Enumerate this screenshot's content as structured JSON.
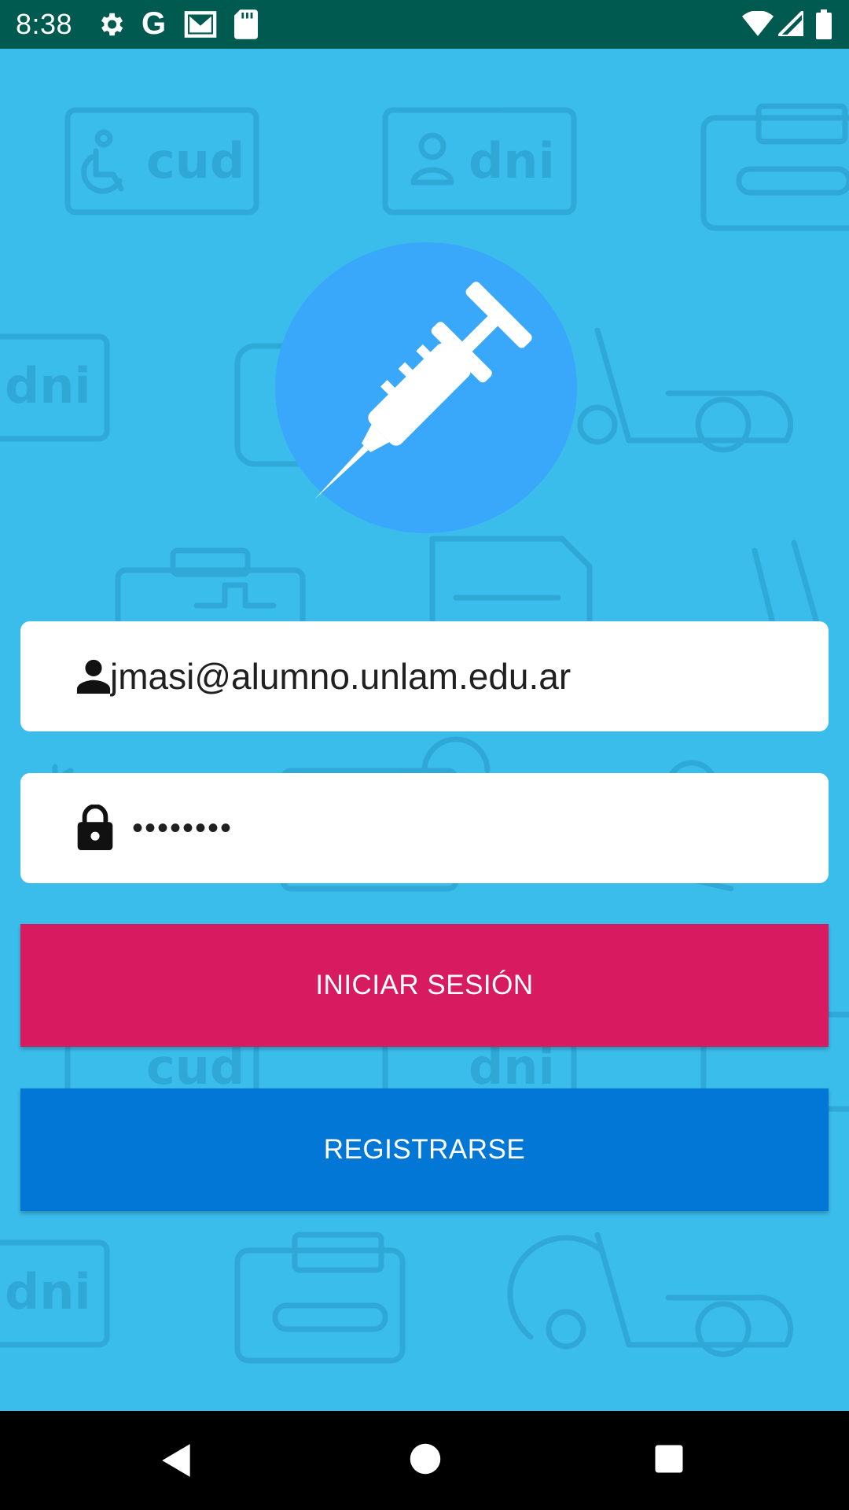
{
  "status_bar": {
    "time": "8:38",
    "icons": [
      "gear-icon",
      "google-icon",
      "gmail-icon",
      "sd-card-icon",
      "wifi-icon",
      "signal-icon",
      "battery-icon"
    ]
  },
  "background": {
    "pattern_labels": [
      "cud",
      "dni",
      "dni",
      "cud",
      "dni",
      "dni"
    ]
  },
  "logo": {
    "icon": "syringe-icon",
    "color": "#3aa8fa"
  },
  "email_field": {
    "icon": "person-icon",
    "value": "jmasi@alumno.unlam.edu.ar"
  },
  "password_field": {
    "icon": "lock-icon",
    "masked_value": "••••••••"
  },
  "login_button": {
    "label": "INICIAR SESIÓN",
    "color": "#d81b60"
  },
  "register_button": {
    "label": "REGISTRARSE",
    "color": "#0277d6"
  },
  "nav_bar": {
    "icons": [
      "back-icon",
      "home-icon",
      "recents-icon"
    ]
  },
  "colors": {
    "background": "#3bbdec",
    "status_bar": "#005a50"
  }
}
